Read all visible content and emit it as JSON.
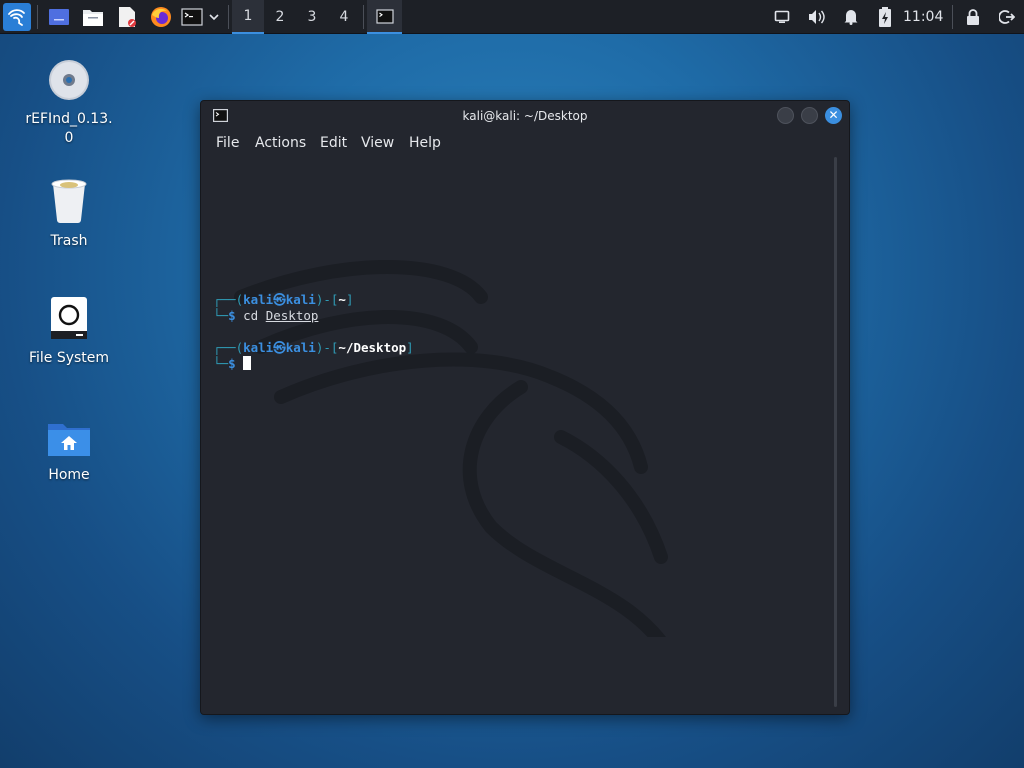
{
  "panel": {
    "workspaces": [
      "1",
      "2",
      "3",
      "4"
    ],
    "active_workspace": "1",
    "clock": "11:04",
    "launchers": [
      "kali-menu-icon",
      "desktop-icon",
      "file-manager-icon",
      "text-editor-icon",
      "firefox-icon",
      "terminal-icon"
    ]
  },
  "desktop": {
    "icons": [
      {
        "label": "rEFInd_0.13.0"
      },
      {
        "label": "Trash"
      },
      {
        "label": "File System"
      },
      {
        "label": "Home"
      }
    ]
  },
  "window": {
    "title": "kali@kali: ~/Desktop",
    "menu": [
      "File",
      "Actions",
      "Edit",
      "View",
      "Help"
    ]
  },
  "terminal": {
    "prompt1": {
      "open": "┌──(",
      "user": "kali",
      "at": "㉿",
      "host": "kali",
      "mid": ")-[",
      "path": "~",
      "close": "]"
    },
    "cmd1": {
      "prefix": "└─",
      "dollar": "$",
      "cmd": "cd",
      "arg": "Desktop"
    },
    "prompt2": {
      "open": "┌──(",
      "user": "kali",
      "at": "㉿",
      "host": "kali",
      "mid": ")-[",
      "path": "~/Desktop",
      "close": "]"
    },
    "cmd2": {
      "prefix": "└─",
      "dollar": "$"
    }
  },
  "colors": {
    "accent": "#3b8fe0",
    "terminal_bg": "#23262e",
    "panel_bg": "#1d2026"
  }
}
